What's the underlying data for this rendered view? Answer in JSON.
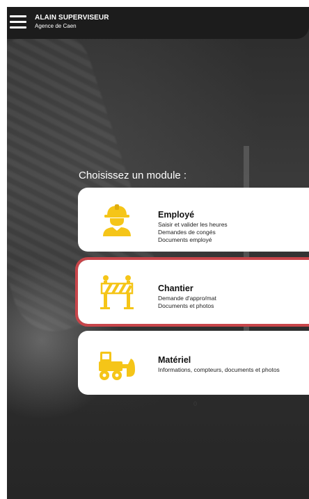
{
  "header": {
    "user_name": "ALAIN SUPERVISEUR",
    "agency": "Agence de Caen",
    "menu_icon": "hamburger-menu-icon"
  },
  "main": {
    "prompt": "Choisissez un module :",
    "modules": [
      {
        "title": "Employé",
        "icon": "worker-hardhat-icon",
        "lines": [
          "Saisir et valider les heures",
          "Demandes de congés",
          "Documents employé"
        ],
        "selected": false
      },
      {
        "title": "Chantier",
        "icon": "construction-barrier-icon",
        "lines": [
          "Demande d'appro/mat",
          "Documents et photos"
        ],
        "selected": true
      },
      {
        "title": "Matériel",
        "icon": "bulldozer-icon",
        "lines": [
          "Informations, compteurs, documents et photos"
        ],
        "selected": false
      }
    ],
    "page_indicator": "0"
  },
  "colors": {
    "accent": "#f5c518",
    "selection_border": "#c8454a",
    "header_bg": "#1c1c1c"
  }
}
